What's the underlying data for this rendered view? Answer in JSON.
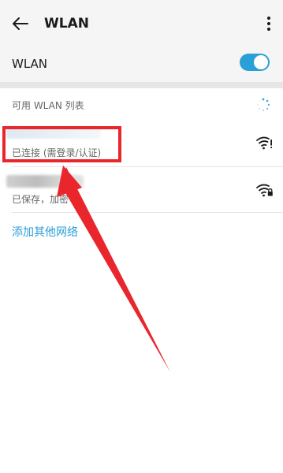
{
  "header": {
    "title": "WLAN",
    "back_icon": "arrow-left-icon",
    "more_icon": "more-vertical-icon"
  },
  "wlan_toggle": {
    "label": "WLAN",
    "state": "on"
  },
  "list": {
    "section_label": "可用 WLAN 列表",
    "networks": [
      {
        "status": "已连接 (需登录/认证)",
        "signal_icon": "wifi-exclamation-icon"
      },
      {
        "status": "已保存，加密",
        "signal_icon": "wifi-lock-icon"
      }
    ]
  },
  "add_network_label": "添加其他网络",
  "colors": {
    "accent": "#2a9fd8",
    "annotation": "#e8262c",
    "header_bg": "#f5f5f5"
  }
}
